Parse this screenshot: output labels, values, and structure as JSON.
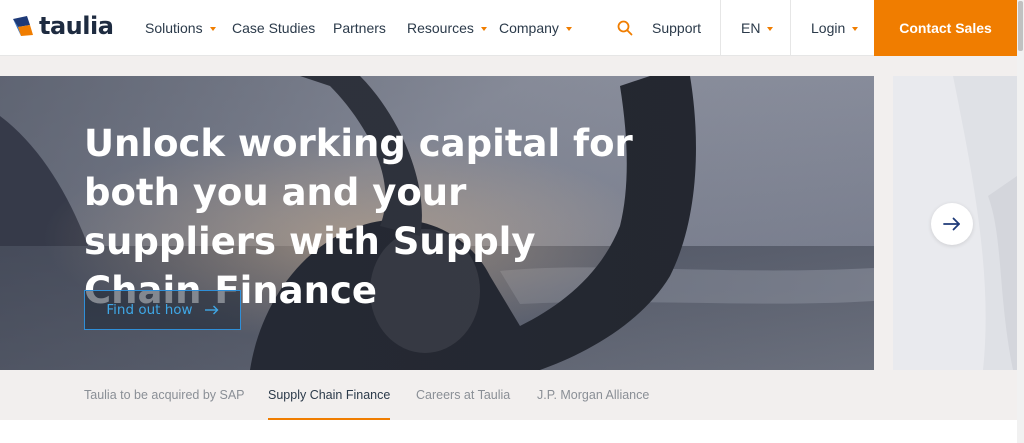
{
  "brand": {
    "name": "taulia",
    "accent": "#f07d00",
    "link_blue": "#3fa7e6"
  },
  "nav": {
    "items": [
      {
        "label": "Solutions",
        "has_dropdown": true
      },
      {
        "label": "Case Studies",
        "has_dropdown": false
      },
      {
        "label": "Partners",
        "has_dropdown": false
      },
      {
        "label": "Resources",
        "has_dropdown": true
      },
      {
        "label": "Company",
        "has_dropdown": true
      }
    ],
    "search_icon": "search-icon",
    "support_label": "Support",
    "language_label": "EN",
    "login_label": "Login",
    "cta_label": "Contact Sales"
  },
  "hero": {
    "title": "Unlock working capital for both you and your suppliers with Supply Chain Finance",
    "button_label": "Find out how",
    "button_icon": "arrow-right-icon",
    "next_icon": "arrow-right-icon"
  },
  "tabs": [
    {
      "label": "Taulia to be acquired by SAP",
      "active": false
    },
    {
      "label": "Supply Chain Finance",
      "active": true
    },
    {
      "label": "Careers at Taulia",
      "active": false
    },
    {
      "label": "J.P. Morgan Alliance",
      "active": false
    }
  ]
}
